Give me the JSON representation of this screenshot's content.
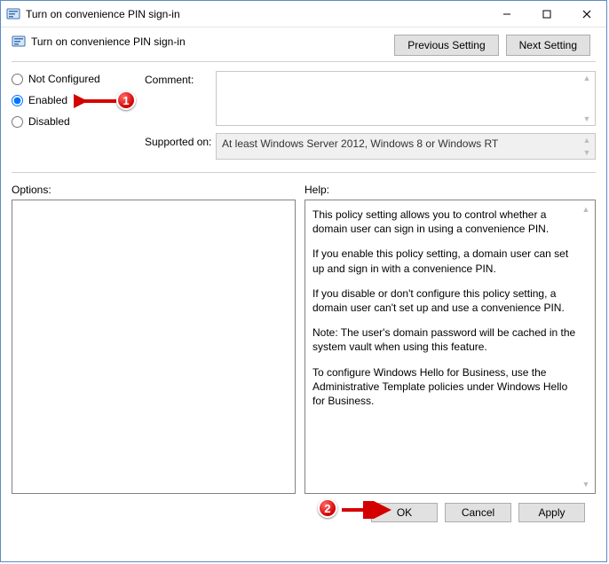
{
  "window": {
    "title": "Turn on convenience PIN sign-in"
  },
  "header": {
    "policy_name": "Turn on convenience PIN sign-in",
    "prev_button": "Previous Setting",
    "next_button": "Next Setting"
  },
  "radios": {
    "not_configured": "Not Configured",
    "enabled": "Enabled",
    "disabled": "Disabled",
    "selected": "enabled"
  },
  "fields": {
    "comment_label": "Comment:",
    "comment_value": "",
    "supported_label": "Supported on:",
    "supported_value": "At least Windows Server 2012, Windows 8 or Windows RT"
  },
  "sections": {
    "options_label": "Options:",
    "help_label": "Help:"
  },
  "help": {
    "p1": "This policy setting allows you to control whether a domain user can sign in using a convenience PIN.",
    "p2": "If you enable this policy setting, a domain user can set up and sign in with a convenience PIN.",
    "p3": "If you disable or don't configure this policy setting, a domain user can't set up and use a convenience PIN.",
    "p4": "Note: The user's domain password will be cached in the system vault when using this feature.",
    "p5": "To configure Windows Hello for Business, use the Administrative Template policies under Windows Hello for Business."
  },
  "footer": {
    "ok": "OK",
    "cancel": "Cancel",
    "apply": "Apply"
  },
  "annotations": {
    "badge1": "1",
    "badge2": "2"
  }
}
